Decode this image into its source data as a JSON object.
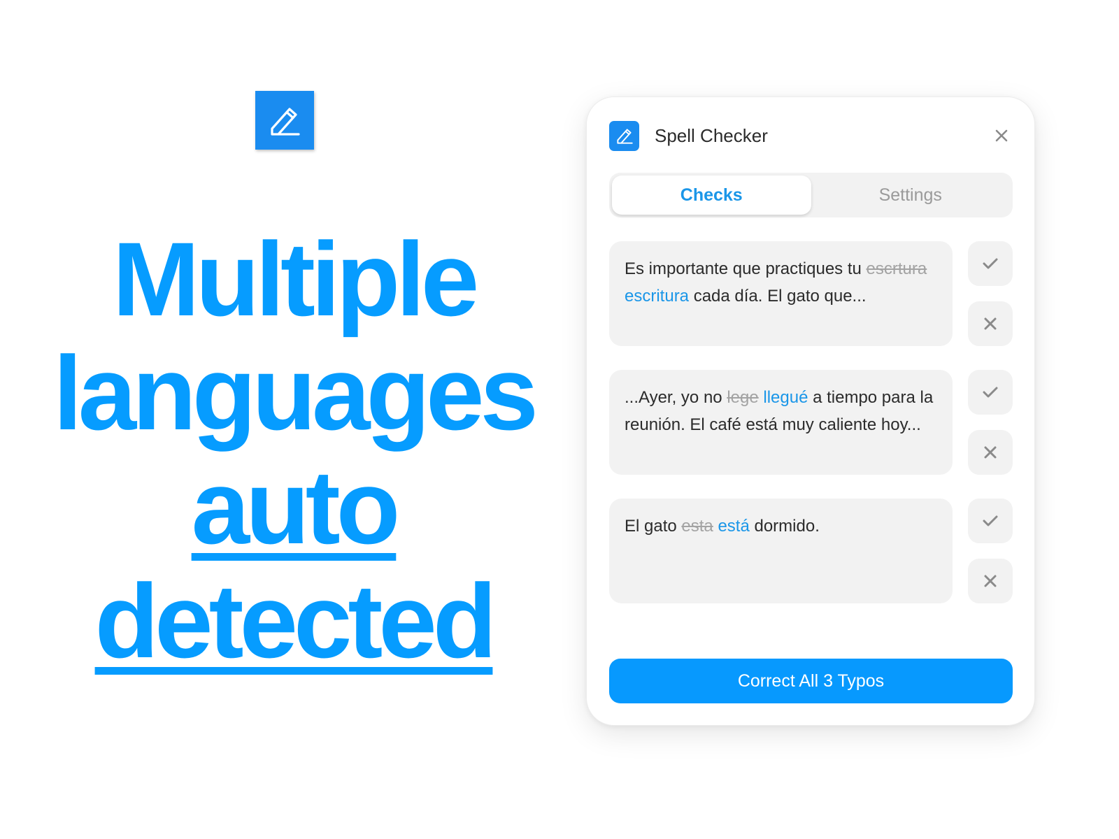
{
  "hero": {
    "logo_icon": "pencil-icon",
    "headline_lines": [
      "Multiple",
      "languages",
      "auto",
      "detected"
    ],
    "accent_color": "#069cff"
  },
  "panel": {
    "title": "Spell Checker",
    "app_icon": "pencil-icon",
    "close_icon": "close-icon",
    "tabs": [
      {
        "label": "Checks",
        "active": true
      },
      {
        "label": "Settings",
        "active": false
      }
    ],
    "checks": [
      {
        "before": "Es importante que practiques tu ",
        "wrong": "escrtura",
        "fix": "escritura",
        "after": " cada día. El gato que...",
        "accept_icon": "check-icon",
        "reject_icon": "x-icon"
      },
      {
        "before": "...Ayer, yo no ",
        "wrong": "lege",
        "fix": "llegué",
        "after": " a tiempo para la reunión. El café está muy caliente hoy...",
        "accept_icon": "check-icon",
        "reject_icon": "x-icon"
      },
      {
        "before": "El gato ",
        "wrong": "esta",
        "fix": "está",
        "after": " dormido.",
        "accept_icon": "check-icon",
        "reject_icon": "x-icon"
      }
    ],
    "correct_all_label": "Correct All 3 Typos",
    "typo_count": 3,
    "colors": {
      "accent": "#1a96e8",
      "button": "#0799fe",
      "card_bg": "#f2f2f2",
      "strike": "#a3a3a3"
    }
  }
}
